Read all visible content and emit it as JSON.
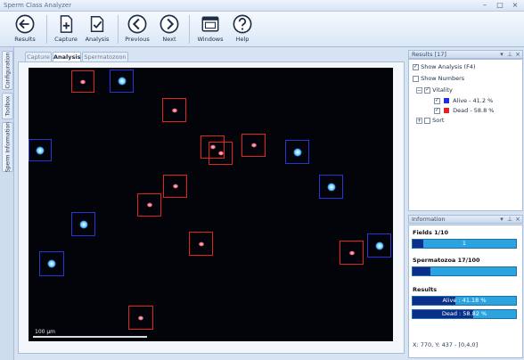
{
  "window": {
    "title": "Sperm Class Analyzer",
    "controls": [
      "–",
      "□",
      "×"
    ]
  },
  "toolbar": {
    "results": "Results",
    "capture": "Capture",
    "analysis": "Analysis",
    "previous": "Previous",
    "next": "Next",
    "windows": "Windows",
    "help": "Help"
  },
  "side_tabs": [
    "Configuration",
    "Toolbox",
    "Sperm Information"
  ],
  "doc_tabs": [
    "Capture",
    "Analysis",
    "Spermatozoon"
  ],
  "image": {
    "scale_label": "100 µm"
  },
  "results_panel": {
    "title": "Results [17]",
    "show_analysis": "Show Analysis (F4)",
    "show_numbers": "Show Numbers",
    "vitality": "Vitality",
    "alive": "Alive - 41.2 %",
    "dead": "Dead - 58.8 %",
    "sort": "Sort",
    "alive_color": "#1f2fe0",
    "dead_color": "#e52222"
  },
  "info_panel": {
    "title": "Information",
    "fields_label": "Fields 1/10",
    "fields_bar_text": "1",
    "fields_progress": 0.1,
    "sperm_label": "Spermatozoa 17/100",
    "sperm_progress": 0.17,
    "results_label": "Results",
    "alive_bar_text": "Alive : 41.18 %",
    "alive_progress": 0.4118,
    "dead_bar_text": "Dead : 58.82 %",
    "dead_progress": 0.5882,
    "coords": "X: 770, Y: 437 - [0,4,0]"
  }
}
